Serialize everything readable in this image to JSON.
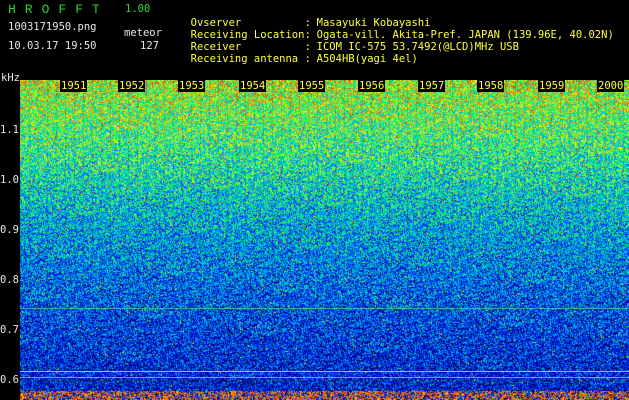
{
  "header": {
    "app_title": "HROFFT",
    "version": "1.00",
    "filename": "1003171950.png",
    "datetime": "10.03.17 19:50",
    "mode_label": "meteor",
    "count": "127"
  },
  "station_info": [
    {
      "label": "Ovserver",
      "value": "Masayuki Kobayashi"
    },
    {
      "label": "Receiving Location",
      "value": "Ogata-vill. Akita-Pref. JAPAN (139.96E, 40.02N)"
    },
    {
      "label": "Receiver",
      "value": "ICOM IC-575 53.7492(@LCD)MHz USB"
    },
    {
      "label": "Receiving antenna",
      "value": "A504HB(yagi 4el)"
    }
  ],
  "spectrogram": {
    "y_unit": "kHz",
    "y_ticks": [
      "1.1",
      "1.0",
      "0.9",
      "0.8",
      "0.7",
      "0.6"
    ],
    "x_ticks": [
      "1951",
      "1952",
      "1953",
      "1954",
      "1955",
      "1956",
      "1957",
      "1958",
      "1959",
      "2000"
    ],
    "colormap": [
      "#00007a",
      "#0022ff",
      "#00b4ff",
      "#00ff66",
      "#ffff00",
      "#ff2200"
    ]
  },
  "colors": {
    "title_green": "#2ed32e",
    "label_yellow": "#ffff3c",
    "text_white": "#e6e6e6"
  }
}
